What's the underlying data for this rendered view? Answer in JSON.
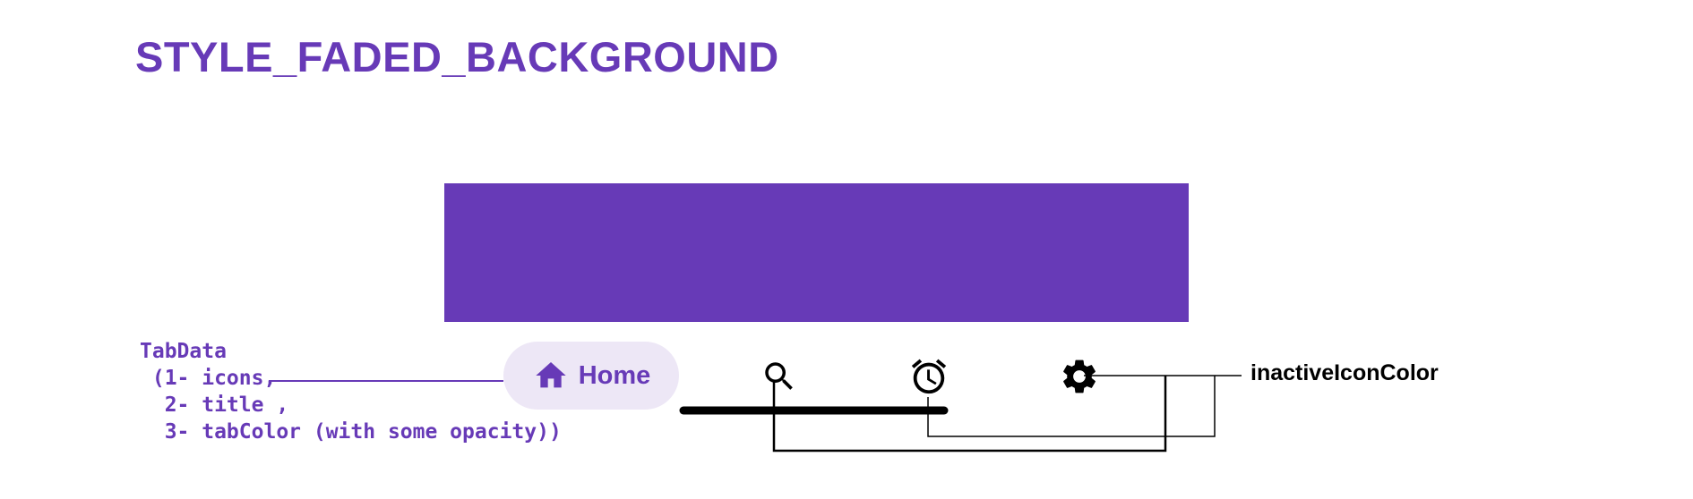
{
  "diagram": {
    "title": "STYLE_FADED_BACKGROUND",
    "tab_data_annotation": "TabData\n (1- icons,\n  2- title ,\n  3- tabColor (with some opacity))",
    "inactive_annotation": "inactiveIconColor"
  },
  "nav_bar": {
    "active_tab": {
      "label": "Home",
      "icon": "home-icon"
    },
    "inactive_tabs": [
      {
        "icon": "search-icon"
      },
      {
        "icon": "alarm-clock-icon"
      },
      {
        "icon": "gear-icon"
      }
    ]
  },
  "colors": {
    "primary": "#673ab7",
    "active_tab_background": "#ede7f6",
    "inactive_icon": "#000000",
    "background": "#ffffff"
  }
}
